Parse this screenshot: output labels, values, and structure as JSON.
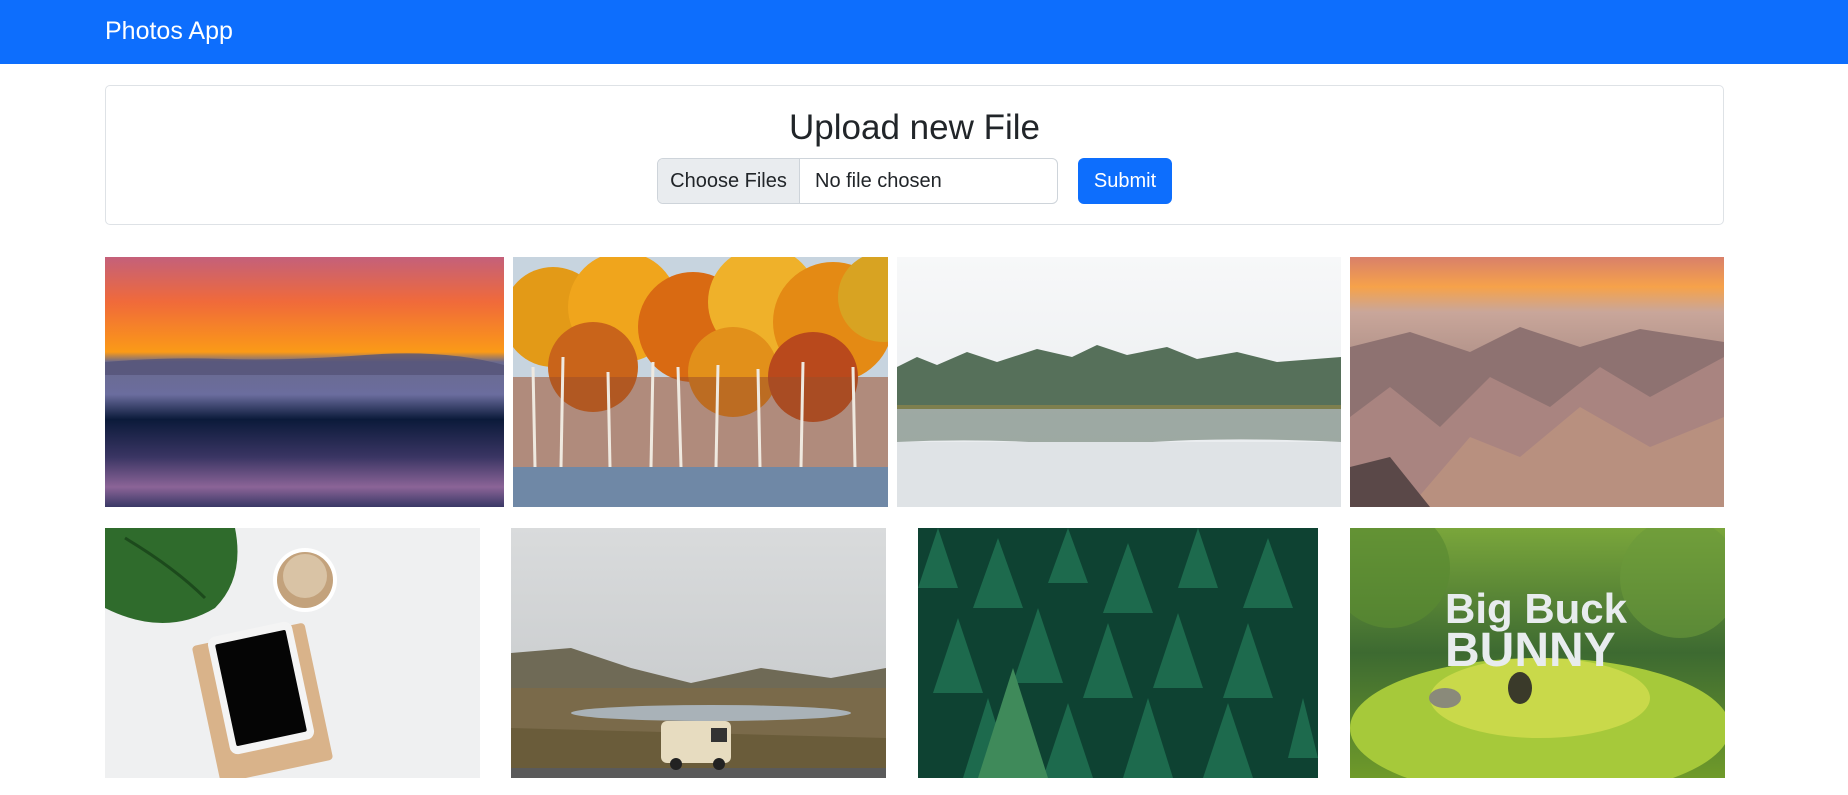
{
  "navbar": {
    "brand": "Photos App"
  },
  "upload": {
    "title": "Upload new File",
    "choose_label": "Choose Files",
    "file_status": "No file chosen",
    "submit_label": "Submit"
  },
  "gallery": {
    "photos": [
      {
        "name": "sunset-sea-photo"
      },
      {
        "name": "autumn-forest-photo"
      },
      {
        "name": "misty-lake-photo"
      },
      {
        "name": "badlands-canyon-photo"
      },
      {
        "name": "tablet-coffee-desk-photo"
      },
      {
        "name": "camper-van-landscape-photo"
      },
      {
        "name": "pine-forest-photo"
      },
      {
        "name": "big-buck-bunny-thumbnail",
        "overlay_text_line1": "Big Buck",
        "overlay_text_line2": "BUNNY"
      }
    ]
  },
  "colors": {
    "brand": "#0d6efd",
    "card_border": "#dee2e6"
  }
}
